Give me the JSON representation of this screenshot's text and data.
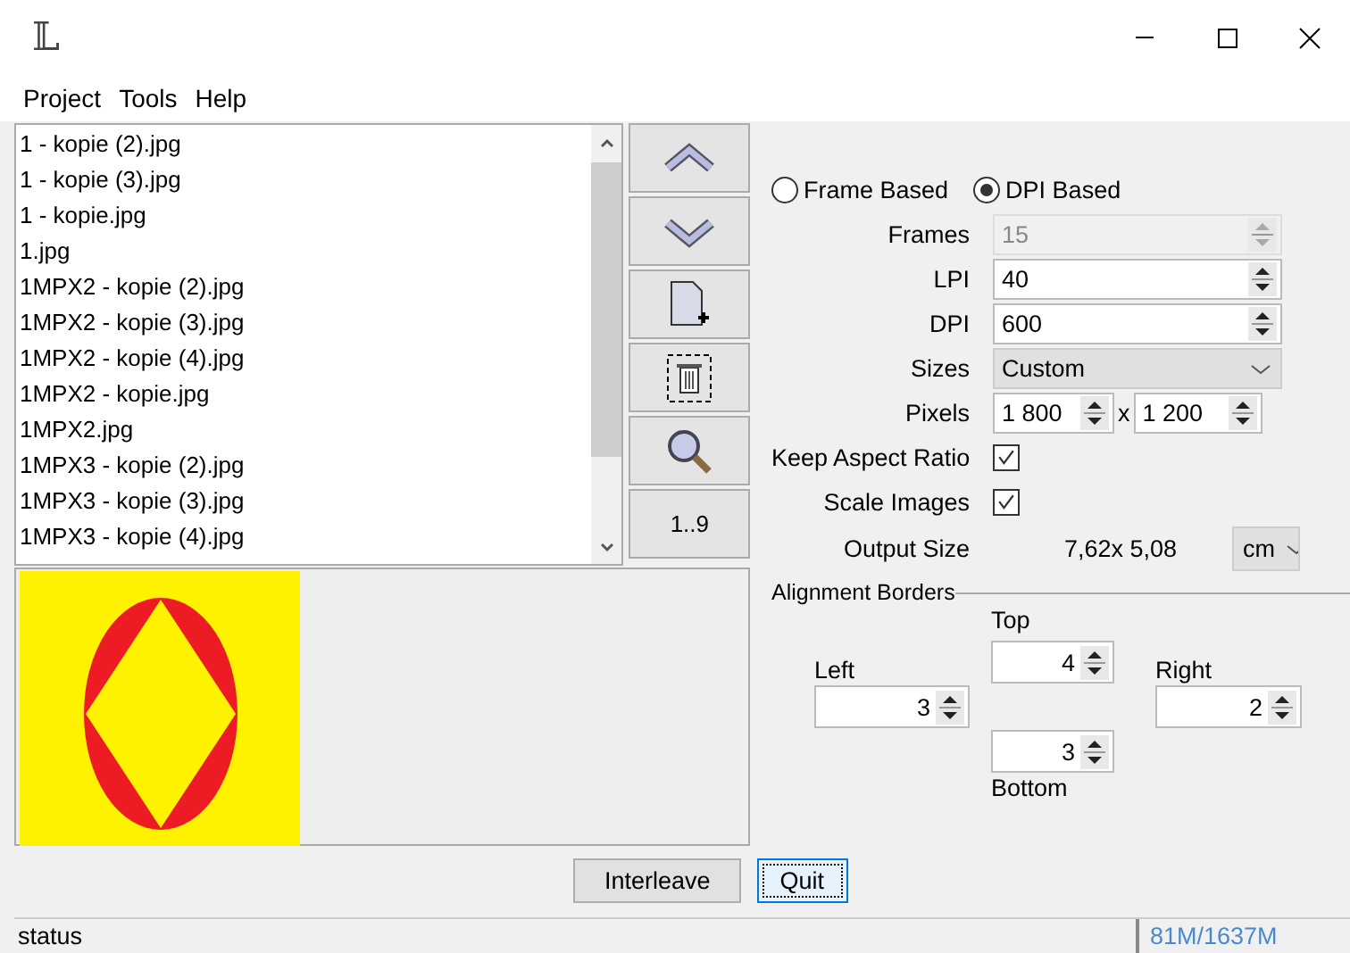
{
  "window": {
    "logo": "𝕃"
  },
  "menu": [
    "Project",
    "Tools",
    "Help"
  ],
  "files": [
    "1 - kopie (2).jpg",
    "1 - kopie (3).jpg",
    "1 - kopie.jpg",
    "1.jpg",
    "1MPX2 - kopie (2).jpg",
    "1MPX2 - kopie (3).jpg",
    "1MPX2 - kopie (4).jpg",
    "1MPX2 - kopie.jpg",
    "1MPX2.jpg",
    "1MPX3 - kopie (2).jpg",
    "1MPX3 - kopie (3).jpg",
    "1MPX3 - kopie (4).jpg"
  ],
  "tool_buttons": [
    {
      "kind": "up"
    },
    {
      "kind": "down"
    },
    {
      "kind": "add"
    },
    {
      "kind": "delete"
    },
    {
      "kind": "zoom"
    },
    {
      "kind": "text",
      "label": "1..9"
    }
  ],
  "mode": [
    {
      "label": "Frame Based",
      "selected": false
    },
    {
      "label": "DPI Based",
      "selected": true
    }
  ],
  "fields": [
    {
      "kind": "spinner",
      "label": "Frames",
      "value": "15",
      "disabled": true
    },
    {
      "kind": "spinner",
      "label": "LPI",
      "value": "40",
      "disabled": false
    },
    {
      "kind": "spinner",
      "label": "DPI",
      "value": "600",
      "disabled": false
    },
    {
      "kind": "dropdown",
      "label": "Sizes",
      "value": "Custom"
    },
    {
      "kind": "pixels",
      "label": "Pixels",
      "width": "1 800",
      "separator": "x",
      "height": "1 200"
    },
    {
      "kind": "checkbox",
      "label": "Keep Aspect Ratio",
      "checked": true
    },
    {
      "kind": "checkbox",
      "label": "Scale Images",
      "checked": true
    },
    {
      "kind": "output",
      "label": "Output Size",
      "value": "7,62x 5,08",
      "unit": "cm"
    }
  ],
  "alignment_borders": {
    "title": "Alignment Borders",
    "top": {
      "label": "Top",
      "value": "4"
    },
    "left": {
      "label": "Left",
      "value": "3"
    },
    "right": {
      "label": "Right",
      "value": "2"
    },
    "bottom": {
      "label": "Bottom",
      "value": "3"
    }
  },
  "buttons": [
    {
      "label": "Interleave",
      "focused": false
    },
    {
      "label": "Quit",
      "focused": true
    }
  ],
  "status_bar": {
    "text": "status",
    "memory": "81M/1637M"
  }
}
